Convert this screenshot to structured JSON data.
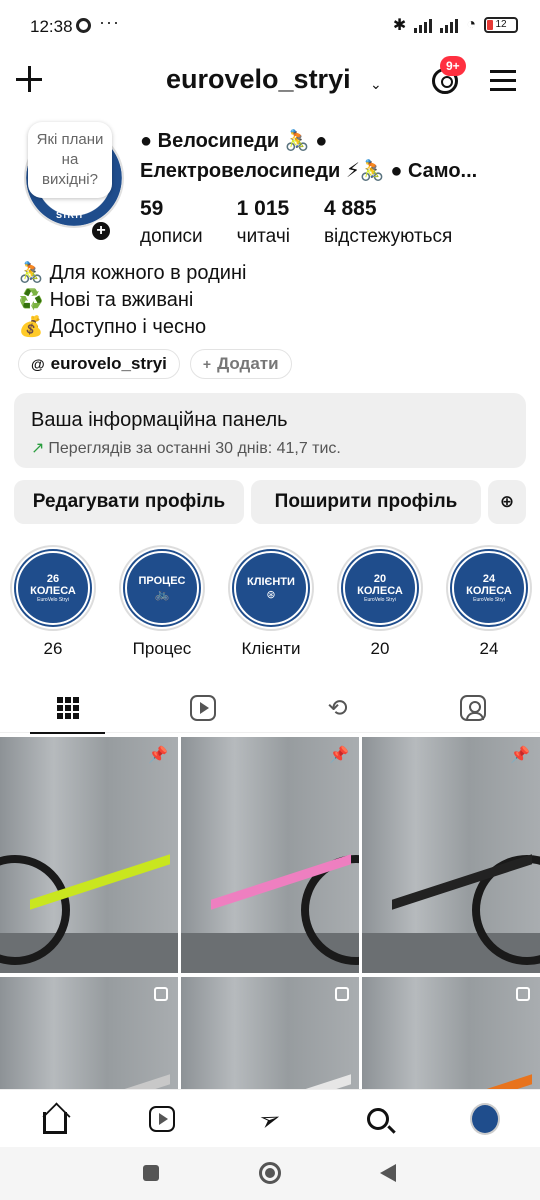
{
  "status_bar": {
    "time": "12:38",
    "dots": "···",
    "battery": "12"
  },
  "header": {
    "username": "eurovelo_stryi",
    "notif_badge": "9+"
  },
  "profile": {
    "note": "Які плани на вихідні?",
    "avatar_text": "STRYI",
    "name_line1": "● Велосипеди 🚴 ●",
    "name_line2": "Електровелосипеди ⚡🚴 ● Само...",
    "stats": [
      {
        "num": "59",
        "label": "дописи"
      },
      {
        "num": "1 015",
        "label": "читачі"
      },
      {
        "num": "4 885",
        "label": "відстежуються"
      }
    ],
    "bio": [
      {
        "emoji": "🚴",
        "text": "Для кожного в родині"
      },
      {
        "emoji": "♻️",
        "text": "Нові та вживані"
      },
      {
        "emoji": "💰",
        "text": "Доступно і чесно"
      }
    ],
    "threads_link": "eurovelo_stryi",
    "add_link": "Додати"
  },
  "dashboard": {
    "title": "Ваша інформаційна панель",
    "subtitle": "Переглядів за останні 30 днів: 41,7 тис."
  },
  "buttons": {
    "edit": "Редагувати профіль",
    "share": "Поширити профіль"
  },
  "highlights": [
    {
      "title": "26",
      "big1": "26",
      "big2": "КОЛЕСА",
      "small": "EuroVelo Stryi"
    },
    {
      "title": "Процес",
      "big1": "ПРОЦЕС",
      "big2": "",
      "small": ""
    },
    {
      "title": "Клієнти",
      "big1": "КЛІЄНТИ",
      "big2": "",
      "small": ""
    },
    {
      "title": "20",
      "big1": "20",
      "big2": "КОЛЕСА",
      "small": "EuroVelo Stryi"
    },
    {
      "title": "24",
      "big1": "24",
      "big2": "КОЛЕСА",
      "small": "EuroVelo Stryi"
    }
  ],
  "tabs": [
    "grid-icon",
    "reels-icon",
    "reposts-icon",
    "tagged-icon"
  ],
  "posts": [
    {
      "frame_color": "#c9e61f",
      "badge": "pin"
    },
    {
      "frame_color": "#ee7fc0",
      "badge": "pin"
    },
    {
      "frame_color": "#222222",
      "badge": "pin"
    },
    {
      "frame_color": "#c8c8c8",
      "badge": "multi"
    },
    {
      "frame_color": "#e6e6e6",
      "badge": "multi"
    },
    {
      "frame_color": "#e8731c",
      "badge": "multi"
    }
  ]
}
